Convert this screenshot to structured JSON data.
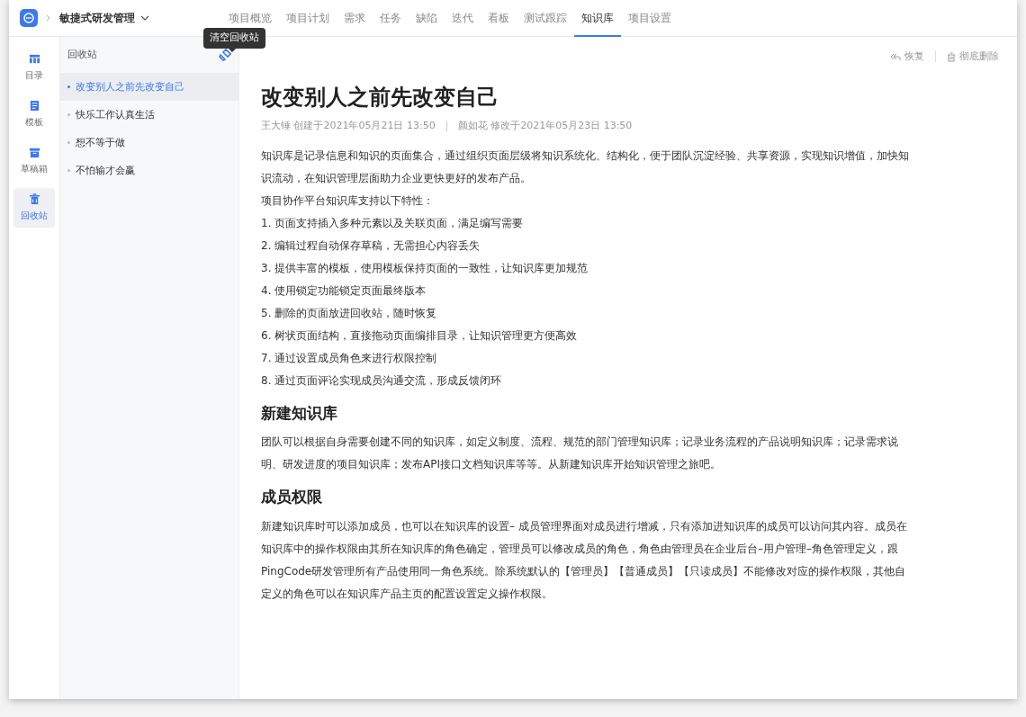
{
  "header": {
    "project": "敏捷式研发管理",
    "tabs": [
      {
        "label": "项目概览",
        "selected": false
      },
      {
        "label": "项目计划",
        "selected": false
      },
      {
        "label": "需求",
        "selected": false
      },
      {
        "label": "任务",
        "selected": false
      },
      {
        "label": "缺陷",
        "selected": false
      },
      {
        "label": "迭代",
        "selected": false
      },
      {
        "label": "看板",
        "selected": false
      },
      {
        "label": "测试跟踪",
        "selected": false
      },
      {
        "label": "知识库",
        "selected": true
      },
      {
        "label": "项目设置",
        "selected": false
      }
    ]
  },
  "tooltip": "清空回收站",
  "rail": [
    {
      "kind": "catalog",
      "label": "目录",
      "selected": false
    },
    {
      "kind": "template",
      "label": "模板",
      "selected": false
    },
    {
      "kind": "drafts",
      "label": "草稿箱",
      "selected": false
    },
    {
      "kind": "trash",
      "label": "回收站",
      "selected": true
    }
  ],
  "panel": {
    "title": "回收站",
    "items": [
      {
        "label": "改变别人之前先改变自己",
        "selected": true
      },
      {
        "label": "快乐工作认真生活",
        "selected": false
      },
      {
        "label": "想不等于做",
        "selected": false
      },
      {
        "label": "不怕输才会赢",
        "selected": false
      }
    ]
  },
  "actions": [
    "恢复",
    "彻底删除"
  ],
  "page": {
    "title": "改变别人之前先改变自己",
    "meta_created": "王大锤 创建于2021年05月21日 13:50",
    "meta_modified": "颜如花 修改于2021年05月23日 13:50",
    "blocks": [
      {
        "kind": "p",
        "text": "知识库是记录信息和知识的页面集合，通过组织页面层级将知识系统化、结构化，便于团队沉淀经验、共享资源，实现知识增值，加快知识流动，在知识管理层面助力企业更快更好的发布产品。"
      },
      {
        "kind": "p",
        "text": "项目协作平台知识库支持以下特性："
      },
      {
        "kind": "p",
        "text": "1. 页面支持插入多种元素以及关联页面，满足编写需要"
      },
      {
        "kind": "p",
        "text": "2. 编辑过程自动保存草稿，无需担心内容丢失"
      },
      {
        "kind": "p",
        "text": "3. 提供丰富的模板，使用模板保持页面的一致性，让知识库更加规范"
      },
      {
        "kind": "p",
        "text": "4. 使用锁定功能锁定页面最终版本"
      },
      {
        "kind": "p",
        "text": "5. 删除的页面放进回收站，随时恢复"
      },
      {
        "kind": "p",
        "text": "6. 树状页面结构，直接拖动页面编排目录，让知识管理更方便高效"
      },
      {
        "kind": "p",
        "text": "7. 通过设置成员角色来进行权限控制"
      },
      {
        "kind": "p",
        "text": "8. 通过页面评论实现成员沟通交流，形成反馈闭环"
      },
      {
        "kind": "h",
        "text": "新建知识库"
      },
      {
        "kind": "p",
        "text": "团队可以根据自身需要创建不同的知识库，如定义制度、流程、规范的部门管理知识库；记录业务流程的产品说明知识库；记录需求说明、研发进度的项目知识库；发布API接口文档知识库等等。从新建知识库开始知识管理之旅吧。"
      },
      {
        "kind": "h",
        "text": "成员权限"
      },
      {
        "kind": "p",
        "text": "新建知识库时可以添加成员，也可以在知识库的设置– 成员管理界面对成员进行增减，只有添加进知识库的成员可以访问其内容。成员在知识库中的操作权限由其所在知识库的角色确定，管理员可以修改成员的角色，角色由管理员在企业后台–用户管理–角色管理定义，跟PingCode研发管理所有产品使用同一角色系统。除系统默认的【管理员】【普通成员】【只读成员】不能修改对应的操作权限，其他自定义的角色可以在知识库产品主页的配置设置定义操作权限。"
      }
    ]
  }
}
